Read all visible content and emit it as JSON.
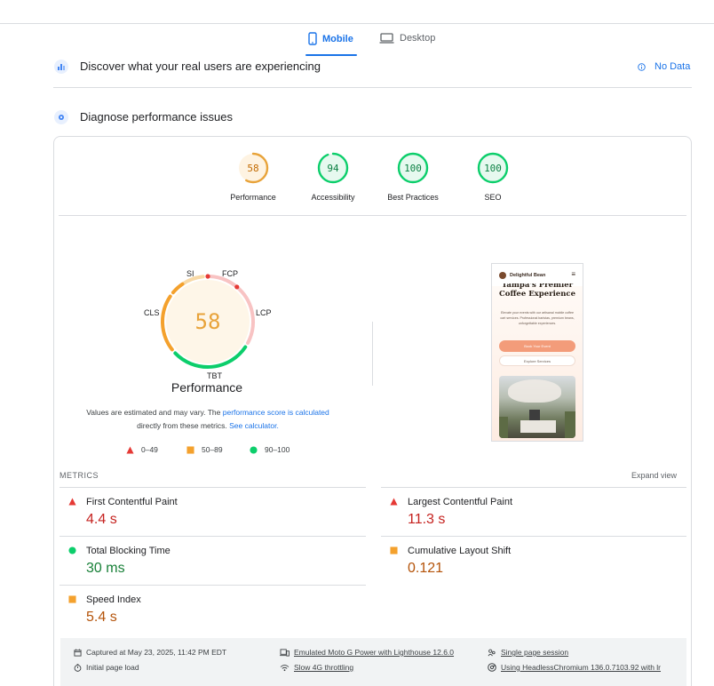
{
  "tabs": [
    {
      "label": "Mobile",
      "icon": "phone-icon",
      "active": true
    },
    {
      "label": "Desktop",
      "icon": "laptop-icon",
      "active": false
    }
  ],
  "crux": {
    "title": "Discover what your real users are experiencing",
    "status": "No Data"
  },
  "diagnose": {
    "title": "Diagnose performance issues"
  },
  "categories": [
    {
      "label": "Performance",
      "score": "58",
      "color": "#e8a33a",
      "fraction": 0.58
    },
    {
      "label": "Accessibility",
      "score": "94",
      "color": "#0cce6b",
      "fraction": 0.94
    },
    {
      "label": "Best Practices",
      "score": "100",
      "color": "#0cce6b",
      "fraction": 1.0
    },
    {
      "label": "SEO",
      "score": "100",
      "color": "#0cce6b",
      "fraction": 1.0
    }
  ],
  "main_gauge": {
    "score": "58",
    "label": "Performance",
    "segments": [
      "SI",
      "FCP",
      "LCP",
      "TBT",
      "CLS"
    ]
  },
  "estimate": {
    "text1": "Values are estimated and may vary. The ",
    "link1": "performance score is calculated",
    "text2": "directly from these metrics. ",
    "link2": "See calculator."
  },
  "legend": [
    {
      "range": "0–49",
      "shape": "triangle",
      "color": "#e53935"
    },
    {
      "range": "50–89",
      "shape": "square",
      "color": "#f4a12d"
    },
    {
      "range": "90–100",
      "shape": "circle",
      "color": "#0cce6b"
    }
  ],
  "preview": {
    "brand": "Delightful Bean",
    "heading1": "Tampa's Premier",
    "heading2": "Coffee Experience",
    "body": "Elevate your events with our artisanal mobile coffee cart services. Professional baristas, premium beans, unforgettable experiences.",
    "cta": "Book Your Event",
    "secondary": "Explore Services"
  },
  "metrics": {
    "header": "METRICS",
    "expand": "Expand view",
    "items": [
      {
        "name": "First Contentful Paint",
        "value": "4.4 s",
        "status": "red"
      },
      {
        "name": "Largest Contentful Paint",
        "value": "11.3 s",
        "status": "red"
      },
      {
        "name": "Total Blocking Time",
        "value": "30 ms",
        "status": "green"
      },
      {
        "name": "Cumulative Layout Shift",
        "value": "0.121",
        "status": "orange"
      },
      {
        "name": "Speed Index",
        "value": "5.4 s",
        "status": "orange"
      }
    ]
  },
  "footer": {
    "captured": "Captured at May 23, 2025, 11:42 PM EDT",
    "load": "Initial page load",
    "device": "Emulated Moto G Power with Lighthouse 12.6.0",
    "throttle": "Slow 4G throttling",
    "session": "Single page session",
    "browser": "Using HeadlessChromium 136.0.7103.92 with lr"
  }
}
